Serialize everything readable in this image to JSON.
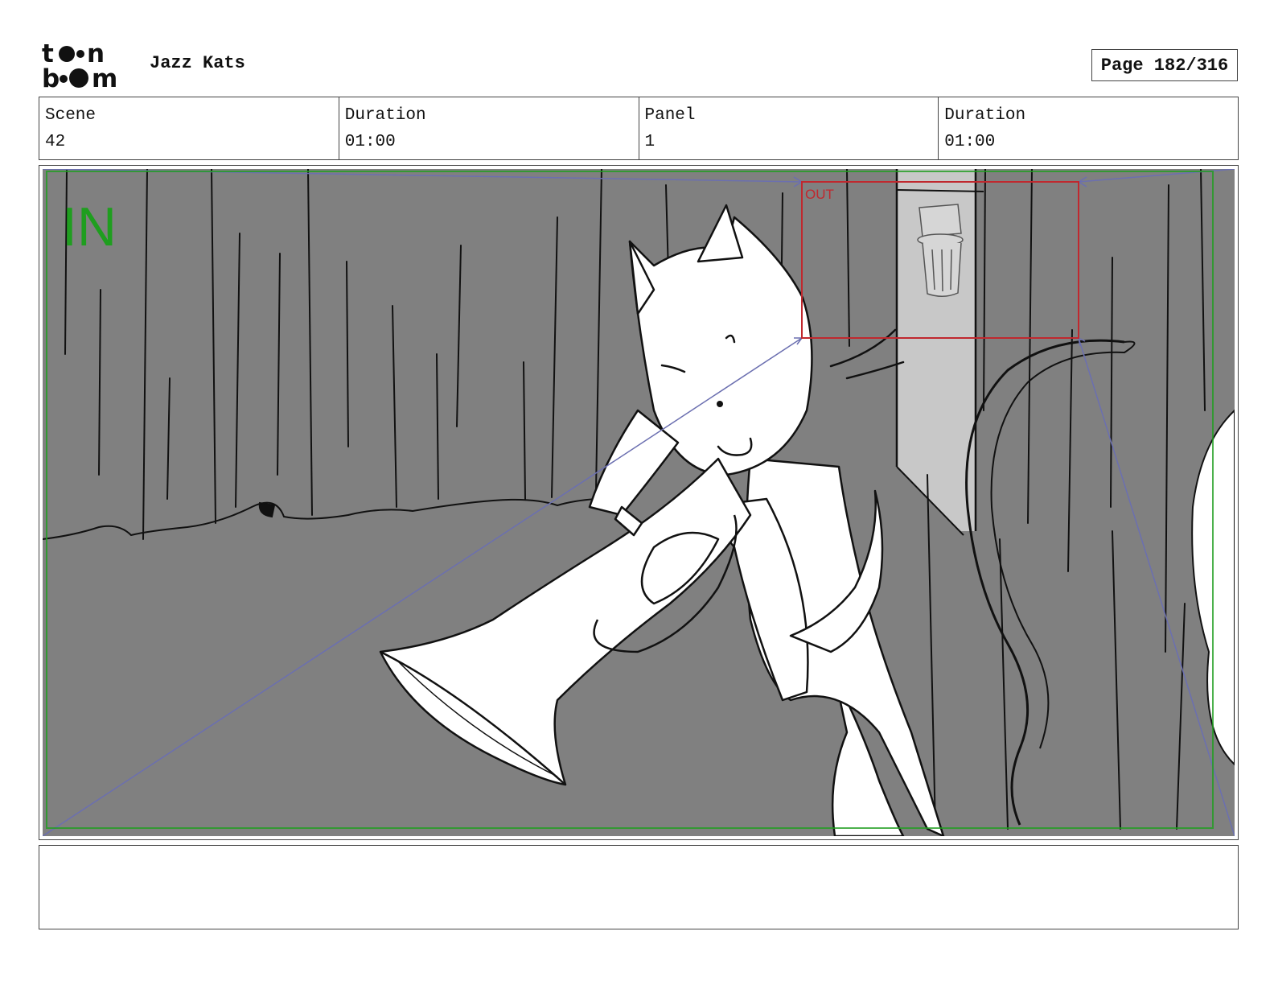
{
  "header": {
    "logo_top": "toon",
    "logo_bottom": "boom",
    "project_title": "Jazz Kats",
    "page_label": "Page 182/316"
  },
  "info": {
    "scene_label": "Scene",
    "scene_value": "42",
    "scene_duration_label": "Duration",
    "scene_duration_value": "01:00",
    "panel_label": "Panel",
    "panel_value": "1",
    "panel_duration_label": "Duration",
    "panel_duration_value": "01:00"
  },
  "panel": {
    "in_label": "IN",
    "out_label": "OUT",
    "in_color": "#1f9e1f",
    "out_color": "#c0282e",
    "camera_path_color": "#6b6fb0",
    "background_color": "#808080"
  },
  "notes": {
    "text": ""
  }
}
